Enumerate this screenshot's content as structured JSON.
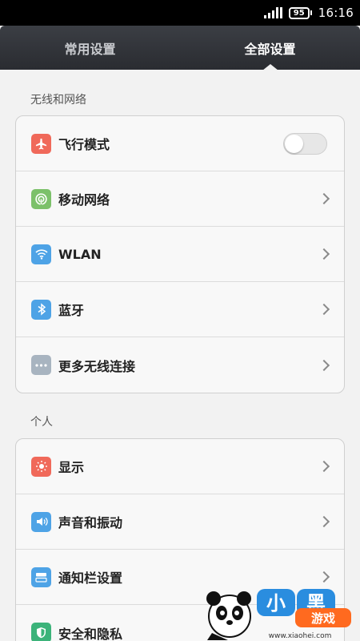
{
  "status": {
    "battery": "95",
    "time": "16:16"
  },
  "tabs": {
    "common": "常用设置",
    "all": "全部设置"
  },
  "sections": {
    "wireless": {
      "header": "无线和网络",
      "items": [
        {
          "label": "飞行模式",
          "icon": "airplane-icon",
          "color": "#f0695a",
          "control": "toggle",
          "toggle_on": false
        },
        {
          "label": "移动网络",
          "icon": "mobile-network-icon",
          "color": "#7cc16a",
          "control": "chevron"
        },
        {
          "label": "WLAN",
          "icon": "wifi-icon",
          "color": "#4ea3e6",
          "control": "chevron"
        },
        {
          "label": "蓝牙",
          "icon": "bluetooth-icon",
          "color": "#4ea3e6",
          "control": "chevron"
        },
        {
          "label": "更多无线连接",
          "icon": "more-icon",
          "color": "#a8b4c0",
          "control": "chevron"
        }
      ]
    },
    "personal": {
      "header": "个人",
      "items": [
        {
          "label": "显示",
          "icon": "display-icon",
          "color": "#f0695a",
          "control": "chevron"
        },
        {
          "label": "声音和振动",
          "icon": "sound-icon",
          "color": "#4ea3e6",
          "control": "chevron"
        },
        {
          "label": "通知栏设置",
          "icon": "notification-bar-icon",
          "color": "#4ea3e6",
          "control": "chevron"
        },
        {
          "label": "安全和隐私",
          "icon": "shield-icon",
          "color": "#3cb37a",
          "control": "none"
        }
      ]
    }
  },
  "watermark": {
    "brand": "小黑游戏",
    "url": "www.xiaohei.com"
  }
}
